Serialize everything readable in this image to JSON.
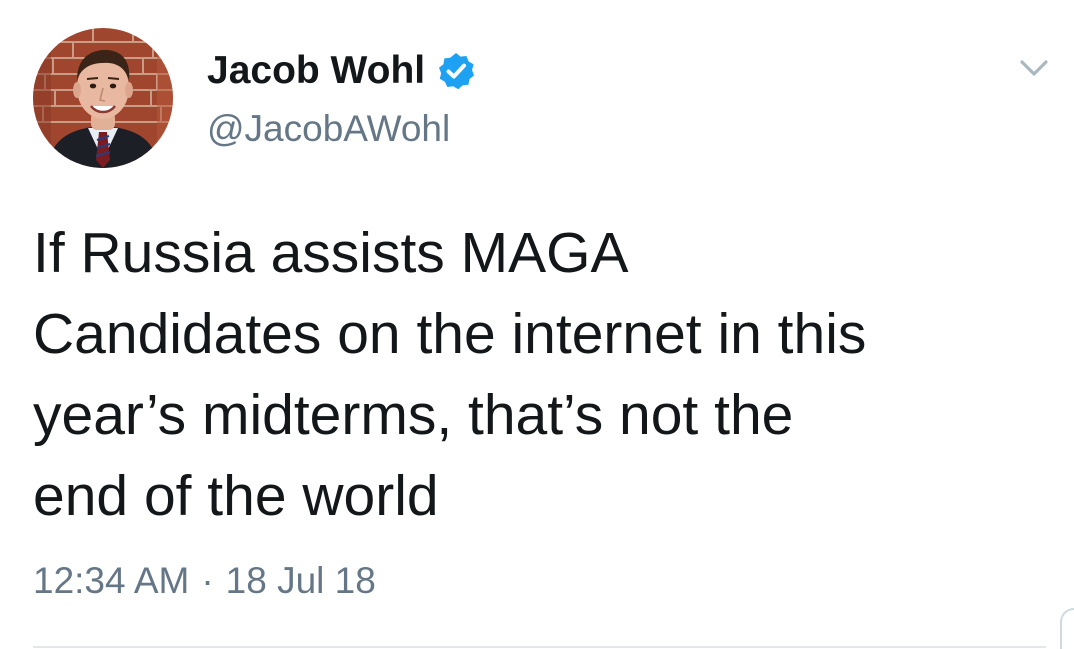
{
  "author": {
    "display_name": "Jacob Wohl",
    "handle": "@JacobAWohl",
    "verified": true,
    "avatar_icon": "profile-photo"
  },
  "tweet": {
    "text_lines": [
      "If Russia assists MAGA",
      "Candidates on the internet in this",
      "year’s midterms, that’s not the",
      "end of the world"
    ],
    "time": "12:34 AM",
    "separator": "·",
    "date": "18 Jul 18"
  },
  "icons": {
    "verified": "verified-badge-icon",
    "menu": "chevron-down-icon"
  },
  "colors": {
    "text": "#14171a",
    "secondary": "#657786",
    "verified_blue": "#1da1f2",
    "divider": "#e1e8ed"
  }
}
